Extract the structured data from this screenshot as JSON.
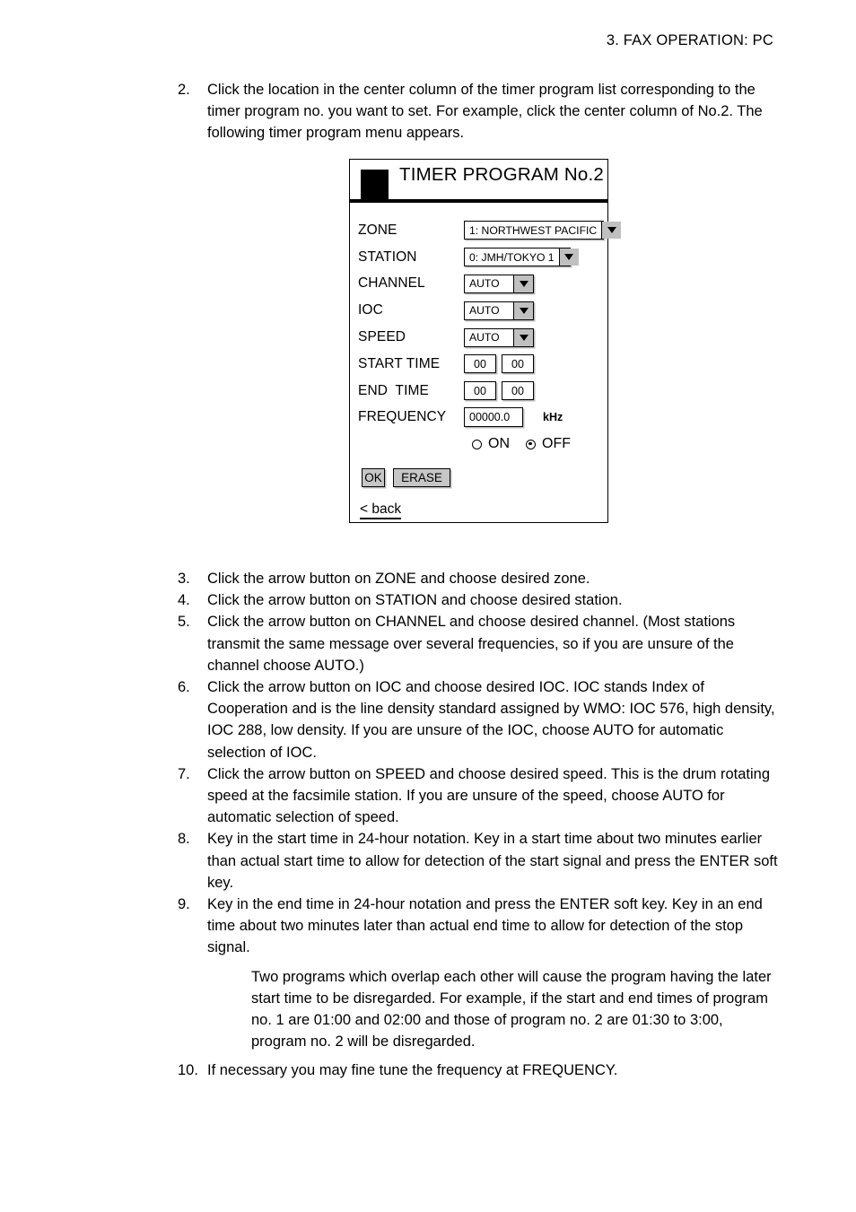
{
  "header": {
    "running_head": "3.  FAX  OPERATION:  PC"
  },
  "steps": [
    {
      "num": "2.",
      "text": "Click the location in the center column of the timer program list corresponding to the timer program no. you want to set. For example, click the center column of No.2. The following timer program menu appears."
    },
    {
      "num": "3.",
      "text": "Click the arrow button on ZONE and choose desired zone."
    },
    {
      "num": "4.",
      "text": "Click the arrow button on STATION and choose desired station."
    },
    {
      "num": "5.",
      "text": "Click the arrow button on CHANNEL and choose desired channel. (Most stations transmit the same message over several frequencies, so if you are unsure of the channel choose AUTO.)"
    },
    {
      "num": "6.",
      "text": "Click the arrow button on IOC and choose desired IOC. IOC stands Index of Cooperation and is the line density standard assigned by WMO: IOC 576, high density, IOC 288, low density. If you are unsure of the IOC, choose AUTO for automatic selection of IOC."
    },
    {
      "num": "7.",
      "text": "Click the arrow button on SPEED and choose desired speed. This is the drum rotating speed at the facsimile station. If you are unsure of the speed, choose AUTO for automatic selection of speed."
    },
    {
      "num": "8.",
      "text": "Key in the start time in 24-hour notation. Key in a start time about two minutes earlier than actual start time to allow for detection of the start signal and press the ENTER soft key."
    },
    {
      "num": "9.",
      "text": "Key in the end time in 24-hour notation and press the ENTER soft key. Key in an end time about two minutes later than actual end time to allow for detection of the stop signal."
    },
    {
      "num": "10.",
      "text": "If necessary you may fine tune the frequency at FREQUENCY."
    }
  ],
  "note": "Two programs which overlap each other will cause the program having the later start time to be disregarded. For example, if the start and end times of program no. 1 are 01:00 and 02:00 and those of program no. 2 are 01:30 to 3:00, program no. 2 will be disregarded.",
  "dialog": {
    "title": "TIMER PROGRAM No.2",
    "fields": {
      "zone_label": "ZONE",
      "zone_value": "1: NORTHWEST PACIFIC",
      "station_label": "STATION",
      "station_value": "0: JMH/TOKYO 1",
      "channel_label": "CHANNEL",
      "channel_value": "AUTO",
      "ioc_label": "IOC",
      "ioc_value": "AUTO",
      "speed_label": "SPEED",
      "speed_value": "AUTO",
      "start_time_label": "START TIME",
      "start_time_hour": "00",
      "start_time_min": "00",
      "end_time_label": "END  TIME",
      "end_time_hour": "00",
      "end_time_min": "00",
      "frequency_label": "FREQUENCY",
      "frequency_value": "00000.0",
      "frequency_unit": "kHz"
    },
    "radios": {
      "on_label": "ON",
      "off_label": "OFF",
      "selected": "OFF"
    },
    "buttons": {
      "ok_label": "OK",
      "erase_label": "ERASE",
      "back_label": "< back"
    }
  }
}
